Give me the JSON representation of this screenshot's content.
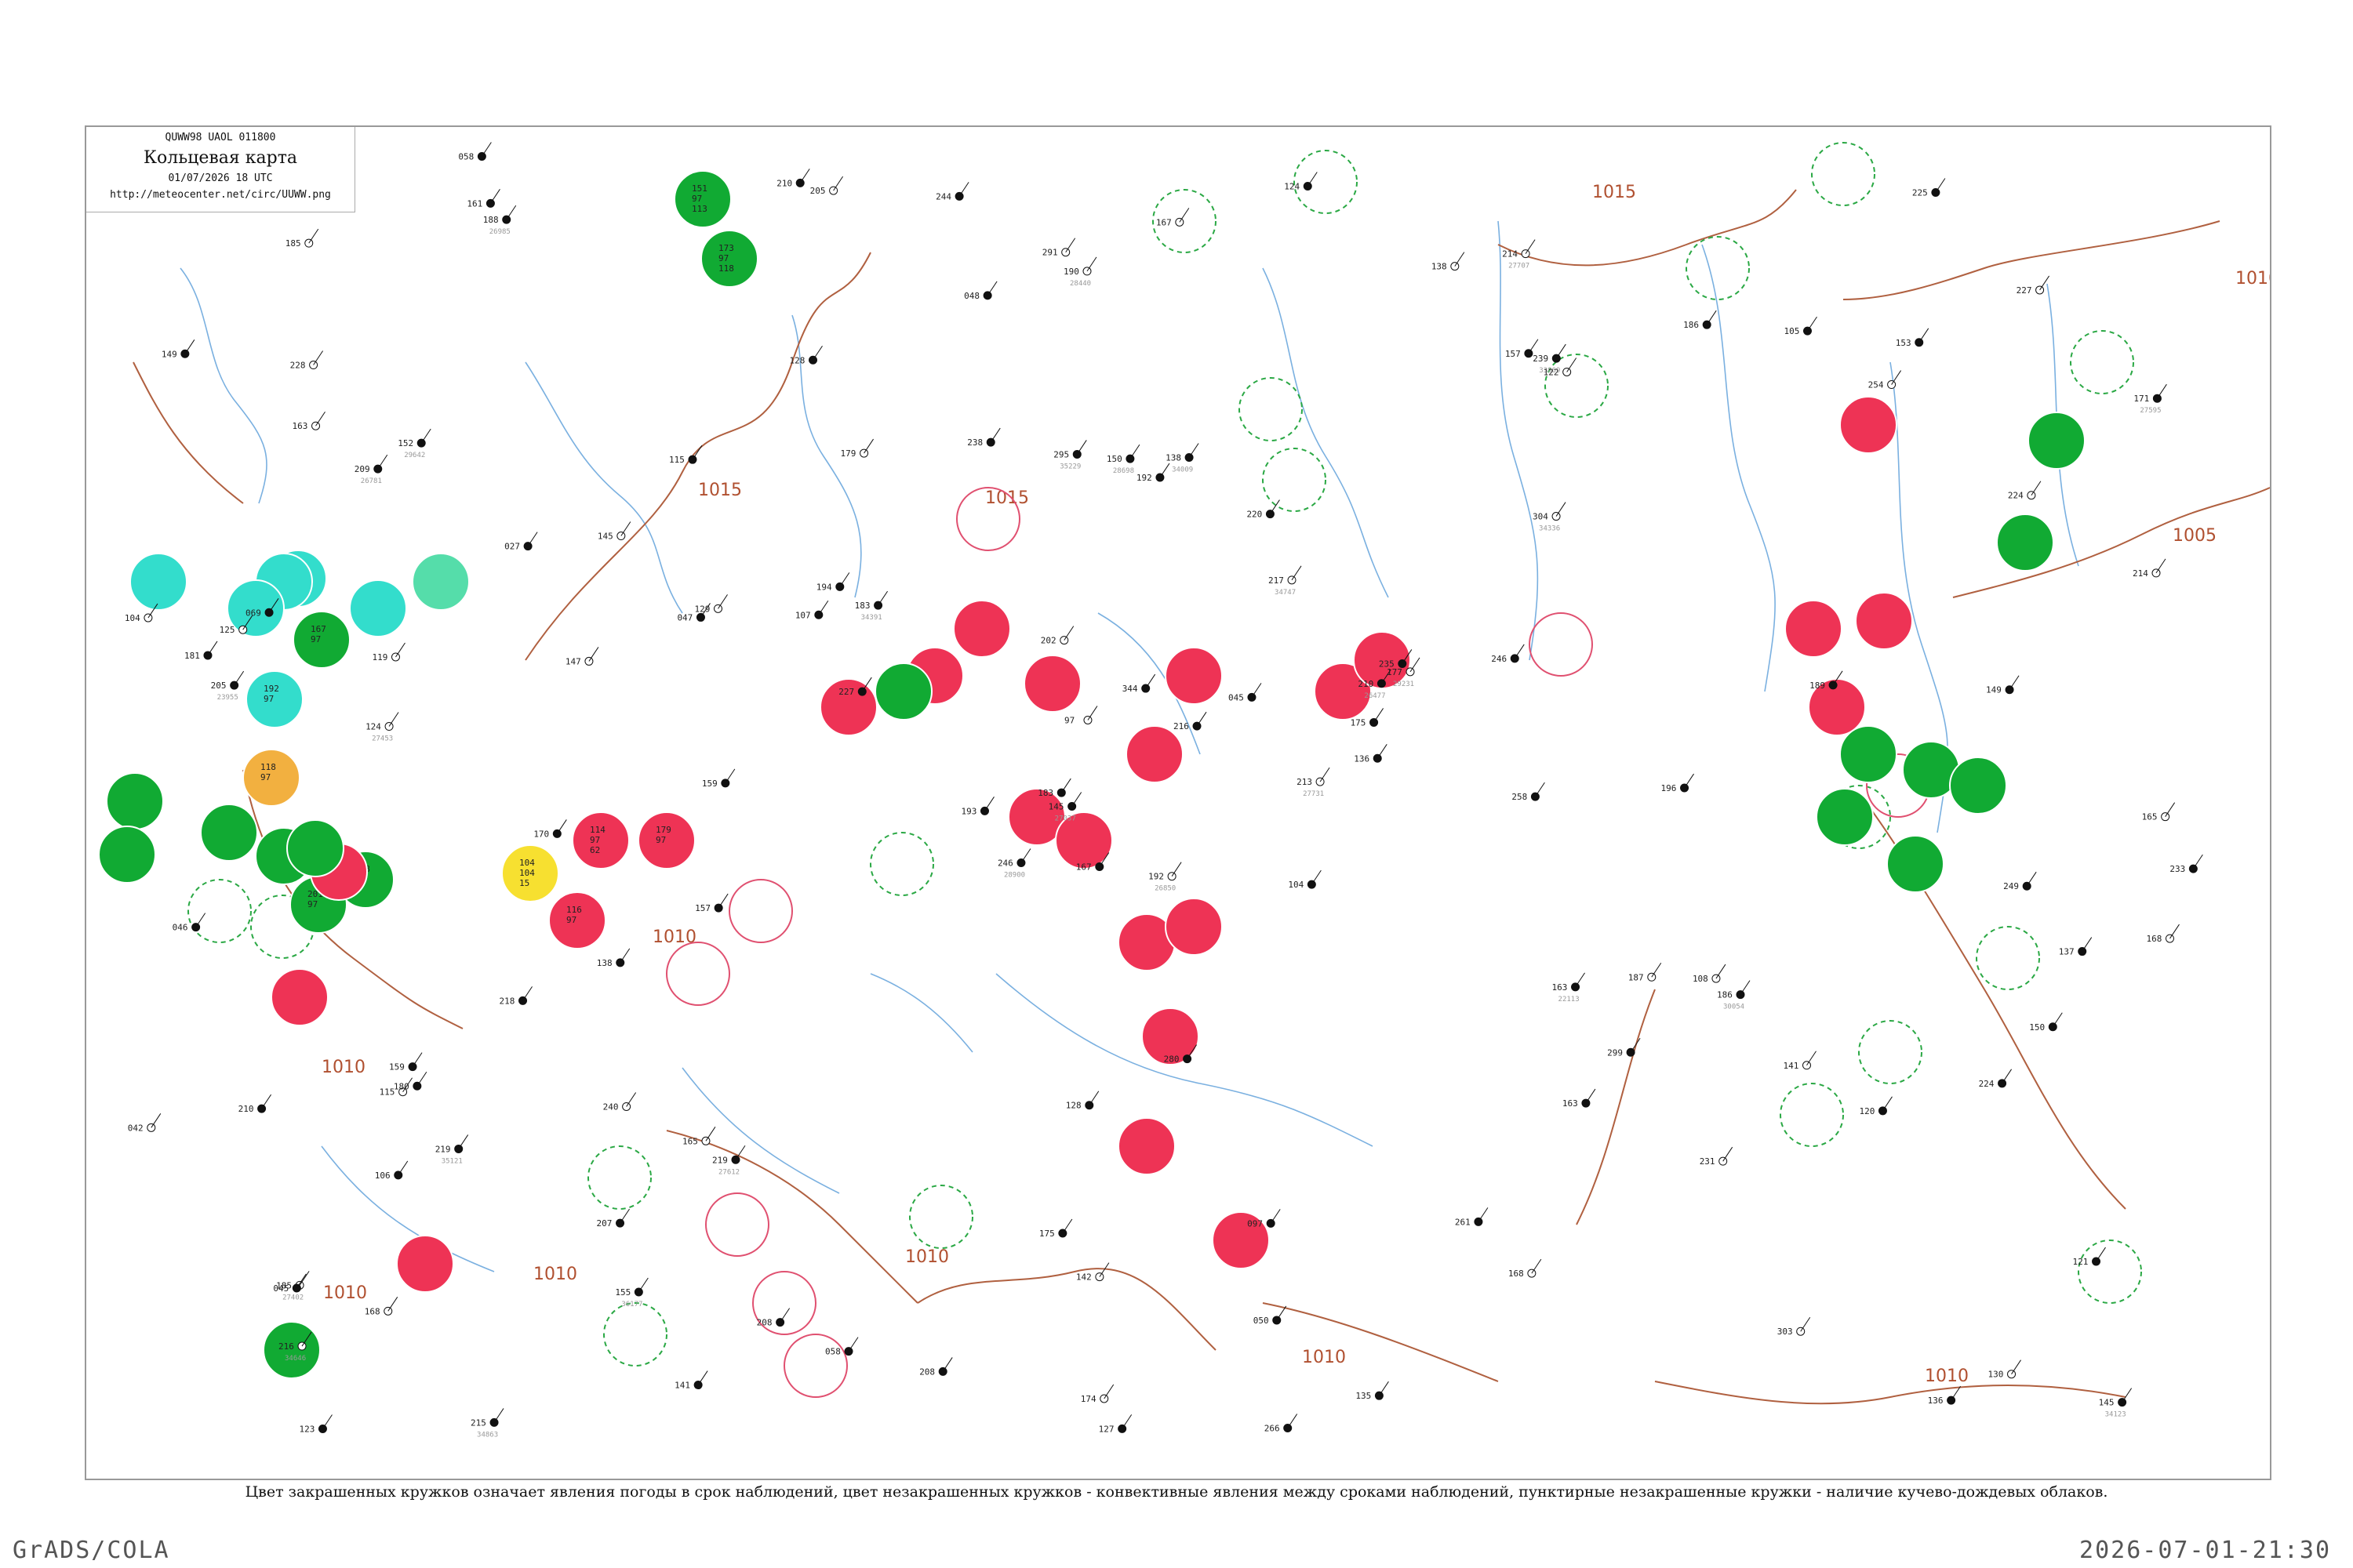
{
  "header": {
    "code_line": "QUWW98  UAOL  011800",
    "title": "Кольцевая карта",
    "date": "01/07/2026 18 UTC",
    "url": "http://meteocenter.net/circ/UUWW.png"
  },
  "caption": "Цвет закрашенных кружков означает явления погоды в срок наблюдений, цвет незакрашенных кружков - конвективные явления между сроками наблюдений, пунктирные незакрашенные кружки - наличие кучево-дождевых облаков.",
  "footer": {
    "left": "GrADS/COLA",
    "right": "2026-07-01-21:30"
  },
  "colors": {
    "thunderstorm": "#ee3355",
    "rain": "#11aa33",
    "shower_light": "#55ddaa",
    "snow_cyan": "#33ddcc",
    "hail": "#f2b040",
    "fog_yellow": "#f7e030",
    "isobar": "#b06040",
    "river": "#7ab0e0"
  },
  "isobars": [
    {
      "label": "1015"
    },
    {
      "label": "1015"
    },
    {
      "label": "1015"
    },
    {
      "label": "1010"
    },
    {
      "label": "1010"
    },
    {
      "label": "1010"
    },
    {
      "label": "1010"
    },
    {
      "label": "1010"
    },
    {
      "label": "1010"
    },
    {
      "label": "1010"
    },
    {
      "label": "1005"
    },
    {
      "label": "1010"
    }
  ],
  "stations": [
    {
      "type": "rain",
      "values": [
        "151",
        "97",
        "113"
      ]
    },
    {
      "type": "rain",
      "values": [
        "173",
        "97",
        "118"
      ]
    },
    {
      "type": "thunderstorm",
      "values": [
        "114",
        "97",
        "62"
      ]
    },
    {
      "type": "thunderstorm",
      "values": [
        "179",
        "97"
      ]
    },
    {
      "type": "snow_cyan",
      "values": [
        "154",
        "97",
        "147"
      ]
    },
    {
      "type": "rain",
      "values": [
        "167",
        "97"
      ]
    },
    {
      "type": "snow_cyan",
      "values": [
        "192",
        "97"
      ]
    },
    {
      "type": "hail",
      "values": [
        "118",
        "97"
      ]
    },
    {
      "type": "rain",
      "values": [
        "208",
        "97"
      ]
    },
    {
      "type": "fog_yellow",
      "values": [
        "104",
        "104",
        "15"
      ]
    },
    {
      "type": "thunderstorm",
      "values": [
        "116",
        "97"
      ]
    },
    {
      "type": "rain",
      "values": [
        "201",
        "97"
      ]
    }
  ],
  "number_labels": [
    "192",
    "209",
    "145",
    "185",
    "210",
    "219",
    "214",
    "138",
    "239",
    "213",
    "188",
    "145",
    "124",
    "171",
    "246",
    "304",
    "215",
    "295",
    "217",
    "219",
    "183",
    "216",
    "155",
    "150",
    "177",
    "186",
    "152",
    "190",
    "205",
    "163",
    "214",
    "183",
    "175",
    "97",
    "115",
    "186",
    "165",
    "136",
    "121",
    "108",
    "124",
    "107",
    "147",
    "163",
    "141",
    "104",
    "175",
    "123",
    "142",
    "136",
    "106",
    "224",
    "149",
    "299",
    "168",
    "207",
    "161",
    "132",
    "097",
    "153",
    "167",
    "159",
    "069",
    "145",
    "105",
    "058",
    "138",
    "048",
    "344",
    "042",
    "128",
    "058",
    "187",
    "047",
    "045",
    "185",
    "027",
    "046",
    "202",
    "050",
    "045",
    "168",
    "258",
    "150",
    "174",
    "149",
    "280",
    "303",
    "266",
    "261",
    "291",
    "233",
    "246",
    "231",
    "216",
    "224",
    "125",
    "127",
    "157",
    "122",
    "170",
    "210",
    "165",
    "181",
    "218",
    "240",
    "208",
    "235",
    "254",
    "227",
    "249",
    "228",
    "192",
    "193",
    "205",
    "210",
    "167",
    "227",
    "238",
    "244",
    "115",
    "225",
    "220",
    "179",
    "196",
    "138",
    "130",
    "208",
    "189",
    "163",
    "180",
    "135",
    "129",
    "128",
    "137",
    "141",
    "157",
    "159",
    "168",
    "194",
    "104",
    "119",
    "120"
  ],
  "station_ids": [
    "26850",
    "26781",
    "27037",
    "27402",
    "26477",
    "27612",
    "27707",
    "34009",
    "33869",
    "27731",
    "26985",
    "34123",
    "27453",
    "27595",
    "28900",
    "34336",
    "34863",
    "35229",
    "34747",
    "35121",
    "34391",
    "34646",
    "36177",
    "28698",
    "29231",
    "30054",
    "29642",
    "28440",
    "23955",
    "22113"
  ]
}
